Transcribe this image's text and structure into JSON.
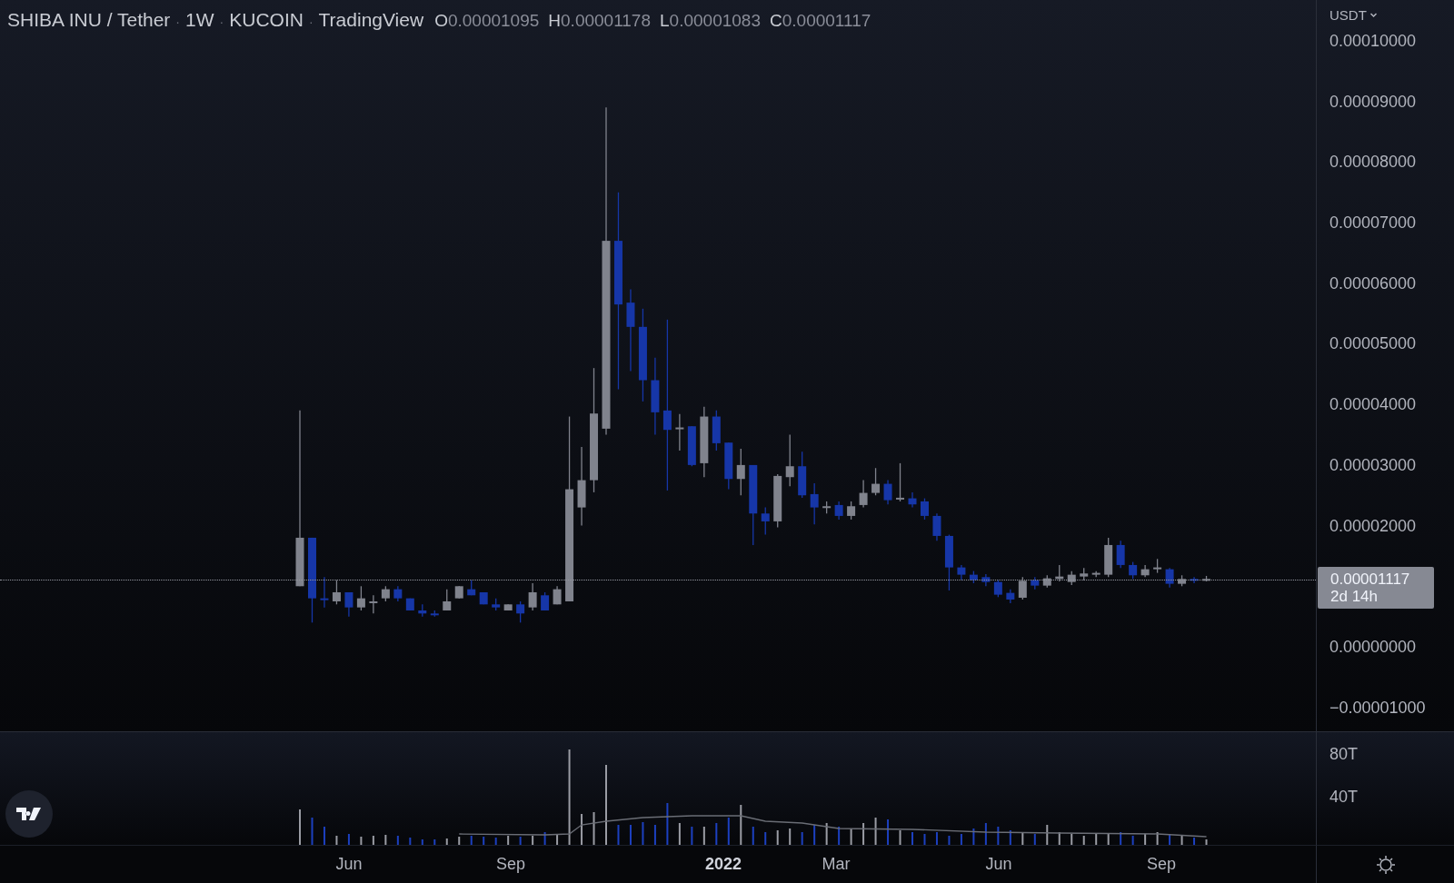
{
  "legend": {
    "symbol": "SHIBA INU / Tether",
    "interval": "1W",
    "exchange": "KUCOIN",
    "source": "TradingView",
    "separator": "·",
    "ohlc": [
      {
        "label": "O",
        "value": "0.00001095"
      },
      {
        "label": "H",
        "value": "0.00001178"
      },
      {
        "label": "L",
        "value": "0.00001083"
      },
      {
        "label": "C",
        "value": "0.00001117"
      }
    ]
  },
  "price_axis": {
    "currency": "USDT",
    "labels": [
      "0.00010000",
      "0.00009000",
      "0.00008000",
      "0.00007000",
      "0.00006000",
      "0.00005000",
      "0.00004000",
      "0.00003000",
      "0.00002000",
      "0.00000000",
      "−0.00001000"
    ],
    "last_price": {
      "value": "0.00001117",
      "countdown": "2d 14h"
    }
  },
  "volume_axis": {
    "labels": [
      "80T",
      "40T"
    ]
  },
  "time_axis": {
    "labels": [
      {
        "text": "Jun",
        "kind": "month"
      },
      {
        "text": "Sep",
        "kind": "month"
      },
      {
        "text": "2022",
        "kind": "year"
      },
      {
        "text": "Mar",
        "kind": "month"
      },
      {
        "text": "Jun",
        "kind": "month"
      },
      {
        "text": "Sep",
        "kind": "month"
      }
    ]
  }
}
